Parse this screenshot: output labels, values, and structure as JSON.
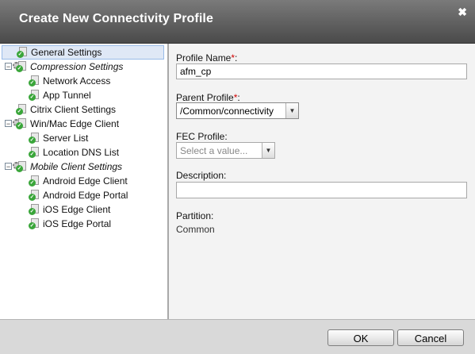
{
  "dialog": {
    "title": "Create New Connectivity Profile",
    "close_glyph": "✖"
  },
  "tree": {
    "items": [
      {
        "label": "General Settings",
        "icon": "check-gear-icon",
        "selected": true
      },
      {
        "label": "Compression Settings",
        "icon": "gear-group-icon",
        "toggle": "−",
        "italic": true
      },
      {
        "label": "Network Access",
        "icon": "check-gear-icon"
      },
      {
        "label": "App Tunnel",
        "icon": "check-gear-icon"
      },
      {
        "label": "Citrix Client Settings",
        "icon": "check-gear-icon"
      },
      {
        "label": "Win/Mac Edge Client",
        "icon": "gear-group-icon",
        "toggle": "−"
      },
      {
        "label": "Server List",
        "icon": "check-gear-icon"
      },
      {
        "label": "Location DNS List",
        "icon": "check-gear-icon"
      },
      {
        "label": "Mobile Client Settings",
        "icon": "gear-group-icon",
        "toggle": "−",
        "italic": true
      },
      {
        "label": "Android Edge Client",
        "icon": "check-gear-icon"
      },
      {
        "label": "Android Edge Portal",
        "icon": "check-gear-icon"
      },
      {
        "label": "iOS Edge Client",
        "icon": "check-gear-icon"
      },
      {
        "label": "iOS Edge Portal",
        "icon": "check-gear-icon"
      }
    ]
  },
  "form": {
    "profile_name": {
      "label": "Profile Name",
      "required_mark": "*",
      "suffix": ":",
      "value": "afm_cp"
    },
    "parent_profile": {
      "label": "Parent Profile",
      "required_mark": "*",
      "suffix": ":",
      "value": "/Common/connectivity"
    },
    "fec_profile": {
      "label": "FEC Profile:",
      "placeholder": "Select a value..."
    },
    "description": {
      "label": "Description:",
      "value": ""
    },
    "partition": {
      "label": "Partition:",
      "value": "Common"
    }
  },
  "footer": {
    "ok_label": "OK",
    "cancel_label": "Cancel"
  },
  "colors": {
    "titlebar": "#5a5a5a",
    "selection": "#dfe8f6",
    "required": "#d00000"
  }
}
